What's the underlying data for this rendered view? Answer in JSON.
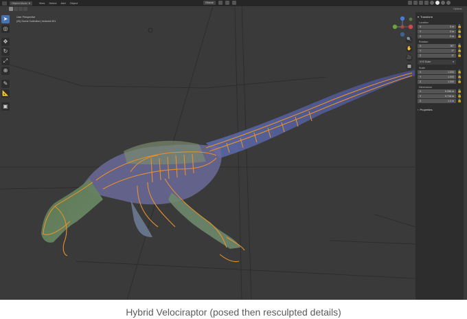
{
  "header": {
    "mode": "Object Mode",
    "menu": [
      "View",
      "Select",
      "Add",
      "Object"
    ],
    "transform_orientation": "Global"
  },
  "viewport": {
    "perspective_label": "User Perspective",
    "collection_label": "(20) Scene Collection | textured.001"
  },
  "toolbar": {
    "tools": [
      {
        "name": "select-tool",
        "glyph": "➤"
      },
      {
        "name": "cursor-tool",
        "glyph": "◎"
      },
      {
        "name": "move-tool",
        "glyph": "✥"
      },
      {
        "name": "rotate-tool",
        "glyph": "↻"
      },
      {
        "name": "scale-tool",
        "glyph": "⤢"
      },
      {
        "name": "transform-tool",
        "glyph": "⊕"
      },
      {
        "name": "annotate-tool",
        "glyph": "✎"
      },
      {
        "name": "measure-tool",
        "glyph": "📐"
      },
      {
        "name": "add-cube-tool",
        "glyph": "▣"
      }
    ]
  },
  "gizmo": {
    "x": "X",
    "y": "Y",
    "z": "Z"
  },
  "sidebar": {
    "tab": "Options",
    "panel_title": "Transform",
    "location_label": "Location",
    "location": [
      {
        "axis": "X",
        "value": "0 m"
      },
      {
        "axis": "Y",
        "value": "0 m"
      },
      {
        "axis": "Z",
        "value": "0 m"
      }
    ],
    "rotation_label": "Rotation",
    "rotation": [
      {
        "axis": "X",
        "value": "90°"
      },
      {
        "axis": "Y",
        "value": "0°"
      },
      {
        "axis": "Z",
        "value": "0°"
      }
    ],
    "rotation_mode": "XYZ Euler",
    "scale_label": "Scale",
    "scale": [
      {
        "axis": "X",
        "value": "1.000"
      },
      {
        "axis": "Y",
        "value": "1.000"
      },
      {
        "axis": "Z",
        "value": "1.000"
      }
    ],
    "dimensions_label": "Dimensions",
    "dimensions": [
      {
        "axis": "X",
        "value": "0.336 m"
      },
      {
        "axis": "Y",
        "value": "0.716 m"
      },
      {
        "axis": "Z",
        "value": "1.4 m"
      }
    ],
    "properties_title": "Properties"
  },
  "caption": "Hybrid Velociraptor (posed then resculpted details)"
}
